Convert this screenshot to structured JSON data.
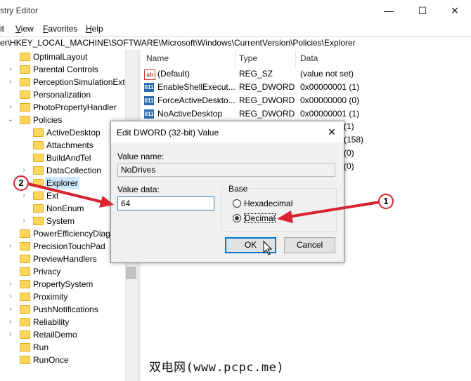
{
  "window": {
    "title": "stry Editor",
    "minimize_glyph": "—",
    "maximize_glyph": "☐",
    "close_glyph": "✕"
  },
  "menubar": {
    "items": [
      {
        "u": "",
        "rest": "it"
      },
      {
        "u": "V",
        "rest": "iew"
      },
      {
        "u": "F",
        "rest": "avorites"
      },
      {
        "u": "H",
        "rest": "elp"
      }
    ]
  },
  "address": {
    "path": "er\\HKEY_LOCAL_MACHINE\\SOFTWARE\\Microsoft\\Windows\\CurrentVersion\\Policies\\Explorer"
  },
  "tree": {
    "items": [
      {
        "label": "OptimalLayout",
        "expander": "",
        "depth": 0
      },
      {
        "label": "Parental Controls",
        "expander": "›",
        "depth": 0
      },
      {
        "label": "PerceptionSimulationExt",
        "expander": "›",
        "depth": 0
      },
      {
        "label": "Personalization",
        "expander": "",
        "depth": 0
      },
      {
        "label": "PhotoPropertyHandler",
        "expander": "›",
        "depth": 0
      },
      {
        "label": "Policies",
        "expander": "⌄",
        "depth": 0
      },
      {
        "label": "ActiveDesktop",
        "expander": "",
        "depth": 1
      },
      {
        "label": "Attachments",
        "expander": "",
        "depth": 1
      },
      {
        "label": "BuildAndTel",
        "expander": "",
        "depth": 1
      },
      {
        "label": "DataCollection",
        "expander": "›",
        "depth": 1
      },
      {
        "label": "Explorer",
        "expander": "",
        "depth": 1,
        "selected": true
      },
      {
        "label": "Ext",
        "expander": "›",
        "depth": 1
      },
      {
        "label": "NonEnum",
        "expander": "",
        "depth": 1
      },
      {
        "label": "System",
        "expander": "›",
        "depth": 1
      },
      {
        "label": "PowerEfficiencyDiagr",
        "expander": "",
        "depth": 0
      },
      {
        "label": "PrecisionTouchPad",
        "expander": "›",
        "depth": 0
      },
      {
        "label": "PreviewHandlers",
        "expander": "",
        "depth": 0
      },
      {
        "label": "Privacy",
        "expander": "",
        "depth": 0
      },
      {
        "label": "PropertySystem",
        "expander": "›",
        "depth": 0
      },
      {
        "label": "Proximity",
        "expander": "›",
        "depth": 0
      },
      {
        "label": "PushNotifications",
        "expander": "›",
        "depth": 0
      },
      {
        "label": "Reliability",
        "expander": "›",
        "depth": 0
      },
      {
        "label": "RetailDemo",
        "expander": "›",
        "depth": 0
      },
      {
        "label": "Run",
        "expander": "",
        "depth": 0
      },
      {
        "label": "RunOnce",
        "expander": "",
        "depth": 0
      }
    ]
  },
  "list": {
    "columns": {
      "name": "Name",
      "type": "Type",
      "data": "Data"
    },
    "rows": [
      {
        "icon": "ab",
        "name": "(Default)",
        "type": "REG_SZ",
        "data": "(value not set)"
      },
      {
        "icon": "011",
        "name": "EnableShellExecut...",
        "type": "REG_DWORD",
        "data": "0x00000001 (1)"
      },
      {
        "icon": "011",
        "name": "ForceActiveDeskto...",
        "type": "REG_DWORD",
        "data": "0x00000000 (0)"
      },
      {
        "icon": "011",
        "name": "NoActiveDesktop",
        "type": "REG_DWORD",
        "data": "0x00000001 (1)"
      }
    ],
    "partial_data": [
      "(1)",
      "(158)",
      "(0)",
      "(0)"
    ]
  },
  "dialog": {
    "title": "Edit DWORD (32-bit) Value",
    "close_glyph": "✕",
    "value_name_label": "Value name:",
    "value_name": "NoDrives",
    "value_data_label": "Value data:",
    "value_data": "64",
    "base_label": "Base",
    "hex_label": "Hexadecimal",
    "dec_label": "Decimal",
    "base_selected": "Decimal",
    "ok_label": "OK",
    "cancel_label": "Cancel"
  },
  "annotations": {
    "badge_1": "1",
    "badge_2": "2",
    "arrow_color": "#d9232e"
  },
  "watermark": "双电网(www.pcpc.me)"
}
